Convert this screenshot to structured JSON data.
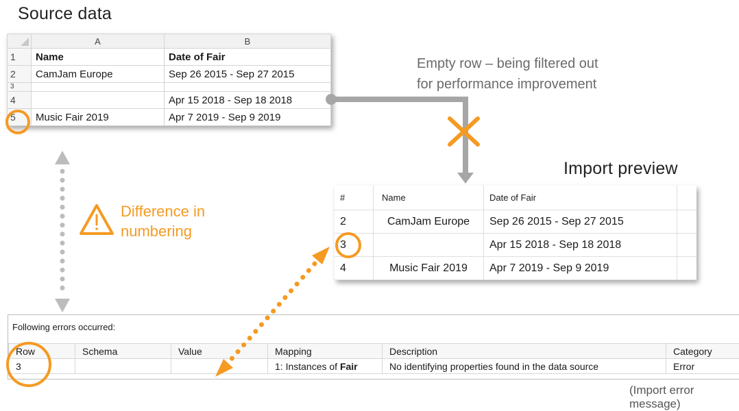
{
  "source_data": {
    "title": "Source data",
    "column_headers": [
      "A",
      "B"
    ],
    "row_numbers": [
      "1",
      "2",
      "3",
      "4",
      "5"
    ],
    "rows": [
      {
        "name": "Name",
        "date": "Date of Fair"
      },
      {
        "name": "CamJam Europe",
        "date": "Sep 26 2015 - Sep 27 2015"
      },
      {
        "name": "",
        "date": ""
      },
      {
        "name": "",
        "date": "Apr 15 2018 - Sep 18 2018"
      },
      {
        "name": "Music Fair 2019",
        "date": "Apr 7 2019 - Sep 9 2019"
      }
    ]
  },
  "empty_row_note": "Empty row – being filtered out\nfor performance improvement",
  "difference_note": "Difference in\nnumbering",
  "import_preview": {
    "title": "Import preview",
    "headers": [
      "#",
      "Name",
      "Date of Fair"
    ],
    "rows": [
      {
        "num": "2",
        "name": "CamJam Europe",
        "date": "Sep 26 2015 - Sep 27 2015"
      },
      {
        "num": "3",
        "name": "",
        "date": "Apr 15 2018 - Sep 18 2018"
      },
      {
        "num": "4",
        "name": "Music Fair 2019",
        "date": "Apr 7 2019 - Sep 9 2019"
      }
    ]
  },
  "errors": {
    "title": "Following errors occurred:",
    "headers": [
      "Row",
      "Schema",
      "Value",
      "Mapping",
      "Description",
      "Category"
    ],
    "row": {
      "row": "3",
      "schema": "",
      "value": "",
      "mapping_prefix": "1: Instances of ",
      "mapping_bold": "Fair",
      "description": "No identifying properties found in the data source",
      "category": "Error"
    },
    "caption": "(Import error message)"
  },
  "colors": {
    "highlight": "#f59a23",
    "connector": "#a6a6a6",
    "dotted": "#bcbcbc"
  }
}
